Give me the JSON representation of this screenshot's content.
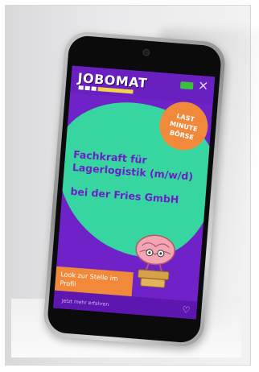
{
  "app": {
    "logo_text": "JOBOMAT",
    "logo_tagline_colors": [
      "#ffffff",
      "#ffffff",
      "#f3d24a",
      "#f3d24a"
    ]
  },
  "badge": {
    "text": "LAST MINUTE BÖRSE"
  },
  "headline": {
    "line1": "Fachkraft für Lagerlogistik (m/w/d)",
    "line2": "bei der Fries GmbH"
  },
  "cta": {
    "label": "Look zur Stelle im Profil"
  },
  "bottom": {
    "text": "Jetzt mehr erfahren"
  },
  "icons": {
    "close": "×",
    "heart": "♡"
  },
  "colors": {
    "screen_purple": "#6f22c8",
    "accent_green": "#37d6a0",
    "accent_orange": "#f08a3a"
  }
}
